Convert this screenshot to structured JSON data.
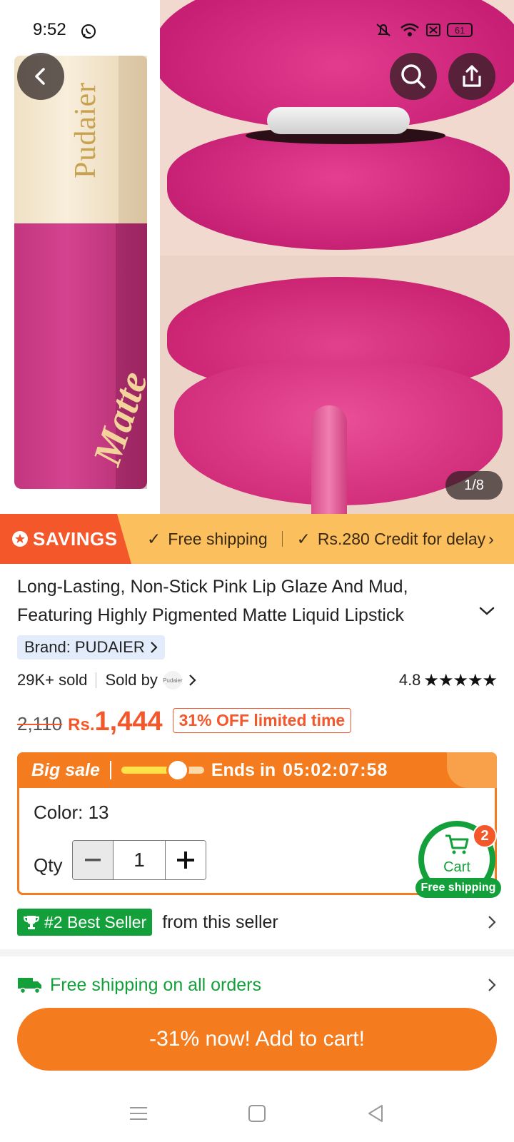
{
  "status_bar": {
    "time": "9:52",
    "battery": "61"
  },
  "gallery": {
    "counter": "1/8",
    "tube_brand": "Pudaier",
    "tube_label": "Matte"
  },
  "savings": {
    "tag": "SAVINGS",
    "items": [
      "Free shipping",
      "Rs.280 Credit for delay"
    ]
  },
  "product": {
    "title": "Long-Lasting, Non-Stick Pink Lip Glaze And Mud, Featuring Highly Pigmented Matte Liquid Lipstick",
    "brand": "Brand: PUDAIER",
    "sold": "29K+ sold",
    "sold_by": "Sold by",
    "seller_logo_text": "Pudaier",
    "rating": "4.8",
    "rating_stars": 5
  },
  "price": {
    "old": "2,110",
    "currency": "Rs.",
    "current": "1,444",
    "discount_badge": "31% OFF limited time"
  },
  "sale": {
    "title": "Big sale",
    "progress": 0.68,
    "ends_label": "Ends in",
    "countdown": "05:02:07:58",
    "color_label": "Color: 13",
    "qty_label": "Qty",
    "qty_value": "1"
  },
  "cart": {
    "label": "Cart",
    "badge": "2",
    "shipping": "Free shipping"
  },
  "bestseller": {
    "badge": "#2 Best Seller",
    "text": "from this seller"
  },
  "shipping_row": {
    "text": "Free shipping on all orders"
  },
  "cta": {
    "label": "-31% now! Add to cart!"
  },
  "colors": {
    "accent": "#f47b1e",
    "savings_red": "#f4572a",
    "green": "#13a03b",
    "savings_bar": "#fcbf5d"
  }
}
